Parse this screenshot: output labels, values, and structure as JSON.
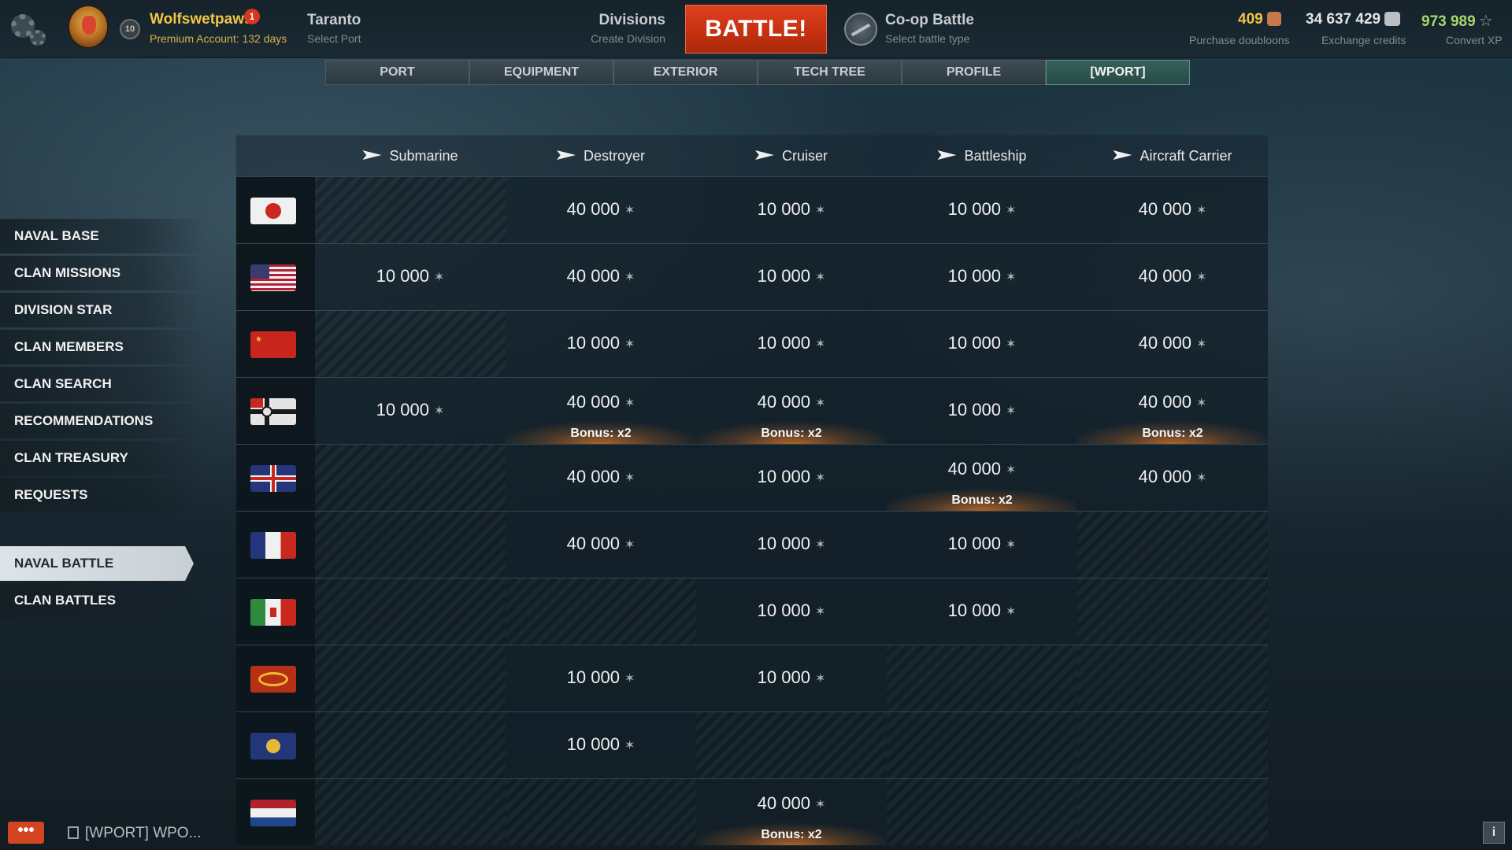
{
  "header": {
    "player": {
      "name": "Wolfswetpaws",
      "notifications": "1",
      "premium": "Premium Account: 132 days",
      "rank": "10"
    },
    "port": {
      "name": "Taranto",
      "sub": "Select Port"
    },
    "division": {
      "name": "Divisions",
      "sub": "Create Division"
    },
    "battle_button": "BATTLE!",
    "battle_type": {
      "name": "Co-op Battle",
      "sub": "Select battle type"
    },
    "currencies": {
      "doubloons": {
        "value": "409",
        "label": "Purchase doubloons",
        "color": "#f2c14a"
      },
      "credits": {
        "value": "34 637 429",
        "label": "Exchange credits",
        "color": "#e6e6e6"
      },
      "xp": {
        "value": "973 989",
        "label": "Convert XP",
        "color": "#a8d870"
      }
    }
  },
  "tabs": [
    "PORT",
    "EQUIPMENT",
    "EXTERIOR",
    "TECH TREE",
    "PROFILE",
    "[WPORT]"
  ],
  "active_tab": "[WPORT]",
  "sidebar": {
    "items": [
      "NAVAL BASE",
      "CLAN MISSIONS",
      "DIVISION STAR",
      "CLAN MEMBERS",
      "CLAN SEARCH",
      "RECOMMENDATIONS",
      "CLAN TREASURY",
      "REQUESTS"
    ],
    "items2": [
      "NAVAL BATTLE",
      "CLAN BATTLES"
    ],
    "active": "NAVAL BATTLE"
  },
  "table": {
    "columns": [
      "Submarine",
      "Destroyer",
      "Cruiser",
      "Battleship",
      "Aircraft Carrier"
    ],
    "star_icon": "star-icon",
    "rows": [
      {
        "nation": "japan",
        "cells": [
          null,
          {
            "v": "40 000"
          },
          {
            "v": "10 000"
          },
          {
            "v": "10 000"
          },
          {
            "v": "40 000"
          }
        ]
      },
      {
        "nation": "usa",
        "cells": [
          {
            "v": "10 000"
          },
          {
            "v": "40 000"
          },
          {
            "v": "10 000"
          },
          {
            "v": "10 000"
          },
          {
            "v": "40 000"
          }
        ]
      },
      {
        "nation": "ussr",
        "cells": [
          null,
          {
            "v": "10 000"
          },
          {
            "v": "10 000"
          },
          {
            "v": "10 000"
          },
          {
            "v": "40 000"
          }
        ]
      },
      {
        "nation": "germany",
        "cells": [
          {
            "v": "10 000"
          },
          {
            "v": "40 000",
            "b": "Bonus: x2"
          },
          {
            "v": "40 000",
            "b": "Bonus: x2"
          },
          {
            "v": "10 000"
          },
          {
            "v": "40 000",
            "b": "Bonus: x2"
          }
        ]
      },
      {
        "nation": "uk",
        "cells": [
          null,
          {
            "v": "40 000"
          },
          {
            "v": "10 000"
          },
          {
            "v": "40 000",
            "b": "Bonus: x2"
          },
          {
            "v": "40 000"
          }
        ]
      },
      {
        "nation": "france",
        "cells": [
          null,
          {
            "v": "40 000"
          },
          {
            "v": "10 000"
          },
          {
            "v": "10 000"
          },
          null
        ]
      },
      {
        "nation": "italy",
        "cells": [
          null,
          null,
          {
            "v": "10 000"
          },
          {
            "v": "10 000"
          },
          null
        ]
      },
      {
        "nation": "pan-asia",
        "cells": [
          null,
          {
            "v": "10 000"
          },
          {
            "v": "10 000"
          },
          null,
          null
        ]
      },
      {
        "nation": "europe",
        "cells": [
          null,
          {
            "v": "10 000"
          },
          null,
          null,
          null
        ]
      },
      {
        "nation": "netherlands",
        "cells": [
          null,
          null,
          {
            "v": "40 000",
            "b": "Bonus: x2"
          },
          null,
          null
        ]
      }
    ]
  },
  "footer": {
    "chat_button": "•••",
    "chat_label": "[WPORT] WPO...",
    "info_button": "i"
  }
}
